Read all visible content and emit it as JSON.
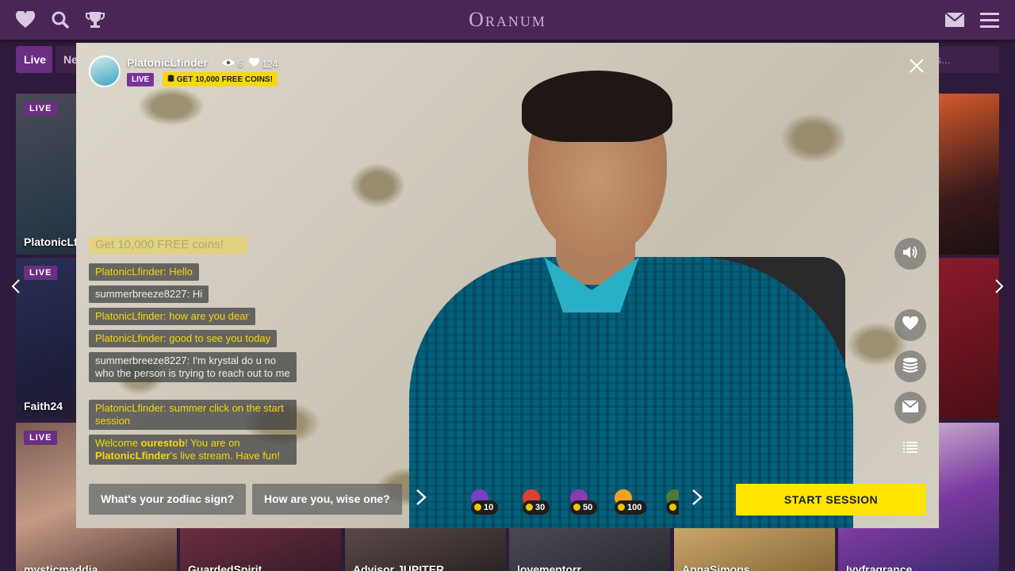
{
  "header": {
    "logo": "Oranum",
    "icons": [
      "heart-icon",
      "search-icon",
      "trophy-icon",
      "mail-icon",
      "menu-icon"
    ]
  },
  "filters": {
    "live_label": "Live",
    "new_label": "Ne",
    "search_placeholder": "s..."
  },
  "grid": {
    "cards": [
      {
        "badge": "LIVE",
        "name": "PlatonicLfi"
      },
      {
        "badge": "LIVE",
        "name": "Faith24"
      },
      {
        "badge": "LIVE",
        "name": ""
      },
      {
        "badge": "",
        "name": "mysticmaddia"
      },
      {
        "badge": "",
        "name": "GuardedSpirit"
      },
      {
        "badge": "",
        "name": "Advisor JUPITER"
      },
      {
        "badge": "",
        "name": "lovementorr"
      },
      {
        "badge": "",
        "name": "AnnaSimons"
      },
      {
        "badge": "",
        "name": "Ivyfragrance"
      }
    ]
  },
  "stream": {
    "performer": "PlatonicLfinder",
    "viewers": "6",
    "likes": "124",
    "live_badge": "LIVE",
    "coins_badge": "GET 10,000 FREE COINS!",
    "faded_message": "Get 10,000 FREE coins!",
    "chat": [
      {
        "text": "PlatonicLfinder: Hello"
      },
      {
        "text": "summerbreeze8227: Hi"
      },
      {
        "text": "PlatonicLfinder: how are you dear"
      },
      {
        "text": "PlatonicLfinder: good to see you today"
      },
      {
        "text": "summerbreeze8227: I'm krystal do u no who the person is trying to reach out to me"
      },
      {
        "text": "PlatonicLfinder: summer click on the start session"
      }
    ],
    "welcome": {
      "p1": "Welcome ",
      "user": "ourestob",
      "p2": "! You are on ",
      "performer": "PlatonicLfinder",
      "p3": "'s live stream. Have fun!"
    },
    "questions": [
      "What's your zodiac sign?",
      "How are you, wise one?"
    ],
    "gifts": [
      {
        "price": "10",
        "color": "#7b3fbf"
      },
      {
        "price": "30",
        "color": "#e0412c"
      },
      {
        "price": "50",
        "color": "#8c3ab5"
      },
      {
        "price": "100",
        "color": "#f0a21c"
      },
      {
        "price": "",
        "color": "#4d7a3b"
      }
    ],
    "start_session": "START SESSION"
  }
}
